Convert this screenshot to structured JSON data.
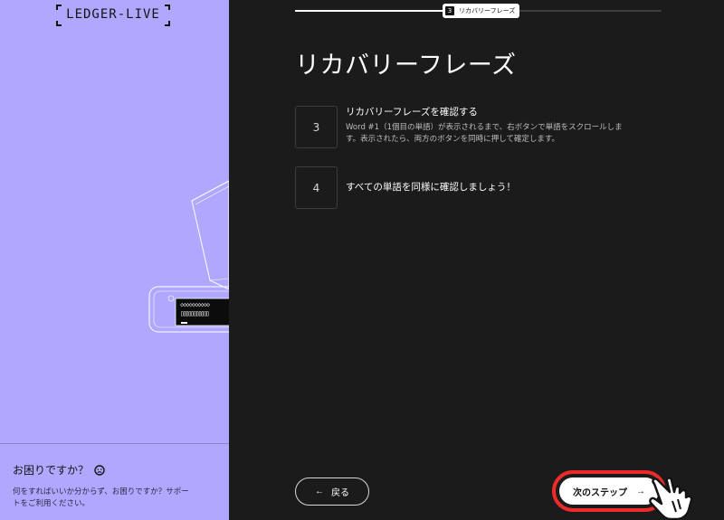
{
  "sidebar": {
    "logo": "LEDGER-LIVE",
    "help_title": "お困りですか？",
    "help_desc_line1": "何をすればいいか分からず、お困りですか？サポー",
    "help_desc_line2": "トをご利用ください。",
    "device_screen_dots": "◇◇◇◇◇◇◇◇◇◇",
    "device_screen_boxes": "▯▯▯▯▯▯▯▯▯▯▯"
  },
  "progress": {
    "step_number": "3",
    "step_label": "リカバリーフレーズ",
    "fraction": 0.42
  },
  "main": {
    "title": "リカバリーフレーズ",
    "steps": [
      {
        "number": "3",
        "heading": "リカバリーフレーズを確認する",
        "body_line1": "Word #1（1個目の単語）が表示されるまで、右ボタンで単語をスクロールしま",
        "body_line2": "す。表示されたら、両方のボタンを同時に押して確定します。"
      },
      {
        "number": "4",
        "heading": "すべての単語を同様に確認しましょう！"
      }
    ]
  },
  "footer": {
    "back_label": "戻る",
    "next_label": "次のステップ",
    "back_arrow": "←",
    "next_arrow": "→"
  },
  "colors": {
    "sidebar_bg": "#b0a8ff",
    "main_bg": "#1b1b1b",
    "highlight": "#ee2a2a"
  }
}
